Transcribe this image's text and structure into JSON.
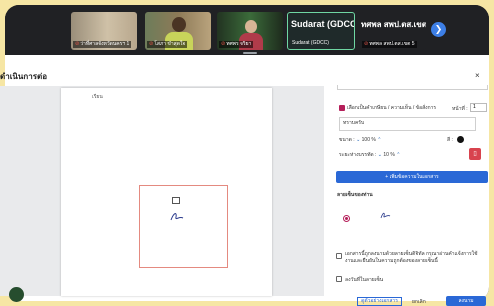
{
  "meeting": {
    "participants": [
      {
        "name": "ว่าที่ศาลจังหวัดนครฯ 1"
      },
      {
        "name": "โสภา ขำสุดใจ"
      },
      {
        "name": "ทศพร จริยา"
      },
      {
        "name": "Sudarat (GDCC)",
        "big_label": "Sudarat (GDCC)"
      },
      {
        "name": "ทศพล สพป.ตส.เขต 5",
        "big_label": "ทศพล สพป.ตส.เขต 5"
      }
    ],
    "next_icon": "chevron-right-icon"
  },
  "dialog": {
    "title": "ดำเนินการต่อ",
    "close_label": "×"
  },
  "document": {
    "small_text": "เรียน"
  },
  "options": {
    "choose_label": "เลือกเป็นคำเกษียน / ความเห็น / ข้อสั่งการ",
    "page_label": "หน้าที่ :",
    "page_value": "1",
    "text_value": "ทราบครับ",
    "size_label": "ขนาด :",
    "size_value": "100 %",
    "color_label": "สี :",
    "color_value": "#111111",
    "spacing_label": "ระยะห่างบรรทัด :",
    "spacing_value": "10 %",
    "add_button": "+ เพิ่มข้อความในเอกสาร",
    "signature_title": "ลายเซ็นของท่าน",
    "consent_text": "เอกสารนี้ถูกลงนามด้วยลายเซ็นดิจิทัล กรุณาอ่านคำแจ้งการใช้งานและยืนยันในความถูกต้องของลายเซ็นนี้",
    "save_text": "ลงวันที่ในลายเซ็น",
    "preview_button": "ดูตัวอย่างเอกสาร",
    "cancel_button": "ยกเลิก",
    "confirm_button": "ลงนาม"
  }
}
